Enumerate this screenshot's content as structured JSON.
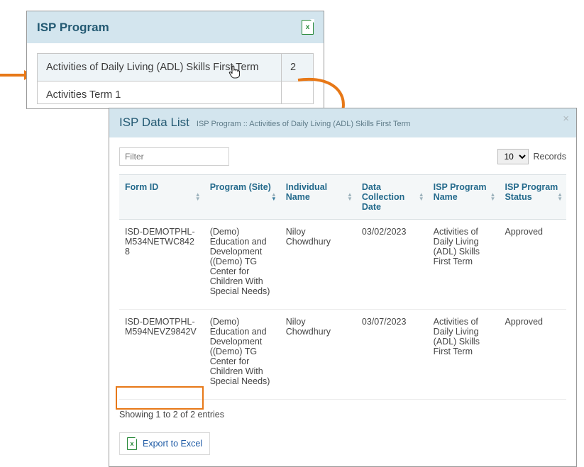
{
  "colors": {
    "accent": "#245a73",
    "orange": "#e77817",
    "excel": "#2a8a3a"
  },
  "small_panel": {
    "title": "ISP Program",
    "rows": [
      {
        "name": "Activities of Daily Living (ADL) Skills First Term",
        "count": "2"
      },
      {
        "name": "Activities Term 1",
        "count": ""
      }
    ]
  },
  "large_panel": {
    "title": "ISP Data List",
    "breadcrumb": "ISP Program :: Activities of Daily Living (ADL) Skills First Term",
    "filter_placeholder": "Filter",
    "records_label": "Records",
    "records_value": "10",
    "columns": [
      "Form ID",
      "Program (Site)",
      "Individual Name",
      "Data Collection Date",
      "ISP Program Name",
      "ISP Program Status"
    ],
    "rows": [
      {
        "form_id": "ISD-DEMOTPHL-M534NETWC8428",
        "program_site": "(Demo) Education and Development ((Demo) TG Center for Children With Special Needs)",
        "individual": "Niloy Chowdhury",
        "date": "03/02/2023",
        "program_name": "Activities of Daily Living (ADL) Skills First Term",
        "status": "Approved"
      },
      {
        "form_id": "ISD-DEMOTPHL-M594NEVZ9842V",
        "program_site": "(Demo) Education and Development ((Demo) TG Center for Children With Special Needs)",
        "individual": "Niloy Chowdhury",
        "date": "03/07/2023",
        "program_name": "Activities of Daily Living (ADL) Skills First Term",
        "status": "Approved"
      }
    ],
    "entries_info": "Showing 1 to 2 of 2 entries",
    "export_label": "Export to Excel"
  }
}
